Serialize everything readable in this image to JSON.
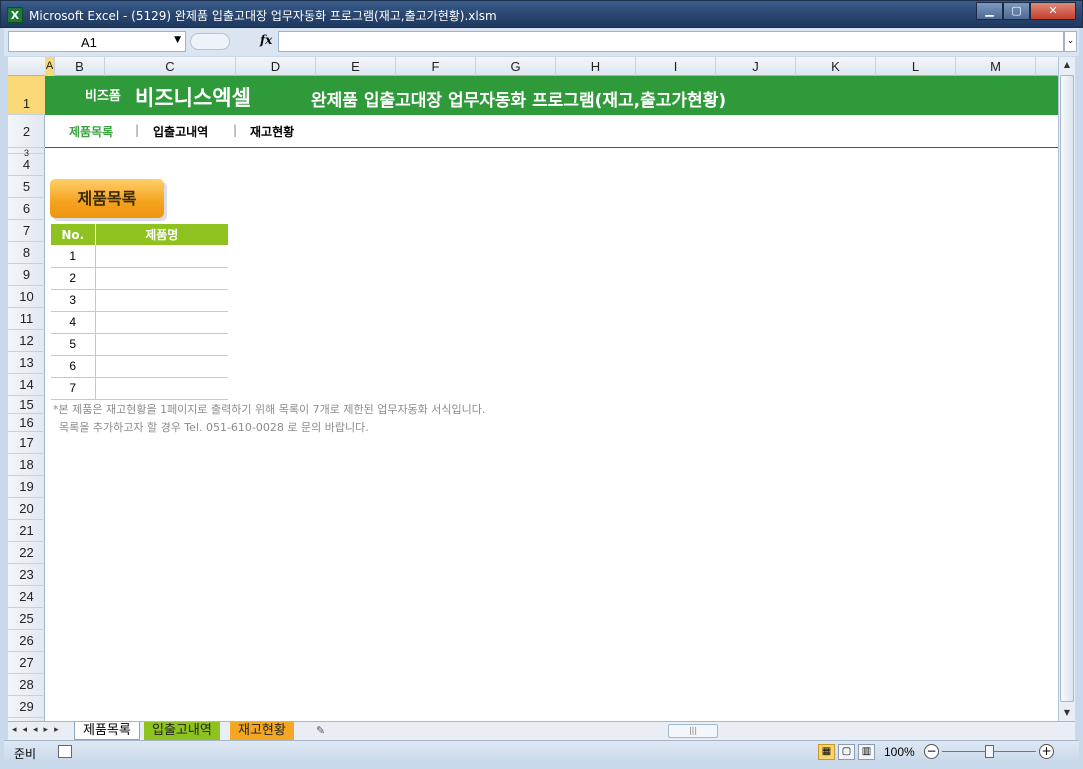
{
  "window": {
    "title": "Microsoft Excel - (5129) 완제품 입출고대장 업무자동화 프로그램(재고,출고가현황).xlsm",
    "app_icon": "excel-icon",
    "buttons": [
      "minimize",
      "maximize",
      "close"
    ]
  },
  "formula_bar": {
    "name_box": "A1",
    "fx_label": "fx",
    "formula": ""
  },
  "columns": [
    "A",
    "B",
    "C",
    "D",
    "E",
    "F",
    "G",
    "H",
    "I",
    "J",
    "K",
    "L",
    "M"
  ],
  "rows": [
    "1",
    "2",
    "3",
    "4",
    "5",
    "6",
    "7",
    "8",
    "9",
    "10",
    "11",
    "12",
    "13",
    "14",
    "15",
    "16",
    "17",
    "18",
    "19",
    "20",
    "21",
    "22",
    "23",
    "24",
    "25",
    "26",
    "27",
    "28",
    "29"
  ],
  "banner": {
    "brand_small": "비즈폼",
    "brand_big": "비즈니스엑셀",
    "title": "완제품 입출고대장 업무자동화 프로그램(재고,출고가현황)"
  },
  "nav": {
    "items": [
      "제품목록",
      "입출고내역",
      "재고현황"
    ],
    "separator": "|"
  },
  "section_button": "제품목록",
  "product_table": {
    "headers": [
      "No.",
      "제품명"
    ],
    "rows": [
      {
        "no": "1",
        "name": ""
      },
      {
        "no": "2",
        "name": ""
      },
      {
        "no": "3",
        "name": ""
      },
      {
        "no": "4",
        "name": ""
      },
      {
        "no": "5",
        "name": ""
      },
      {
        "no": "6",
        "name": ""
      },
      {
        "no": "7",
        "name": ""
      }
    ]
  },
  "notes": {
    "line1": "*본 제품은 재고현황을 1페이지로 출력하기 위해 목록이 7개로 제한된 업무자동화 서식입니다.",
    "line2": "목록을 추가하고자 할 경우 Tel. 051-610-0028 로 문의 바랍니다."
  },
  "sheet_tabs": [
    "제품목록",
    "입출고내역",
    "재고현황"
  ],
  "status": {
    "ready": "준비",
    "zoom": "100%"
  },
  "colors": {
    "banner_green": "#2f9a3a",
    "table_header_green": "#8dc21f",
    "pill_orange": "#f4a21c",
    "nav_active": "#3aa33d"
  }
}
